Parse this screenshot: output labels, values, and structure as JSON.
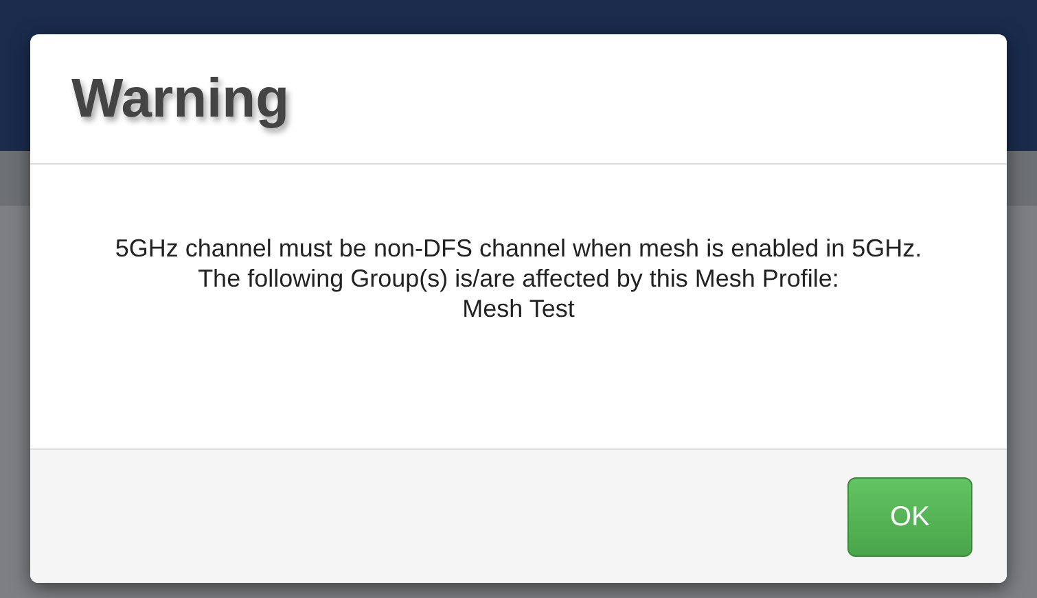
{
  "dialog": {
    "title": "Warning",
    "message_lines": [
      "5GHz channel must be non-DFS channel when mesh is enabled in 5GHz. The following Group(s) is/are affected by this Mesh Profile:",
      "Mesh Test"
    ],
    "buttons": [
      {
        "label": "OK"
      }
    ]
  }
}
